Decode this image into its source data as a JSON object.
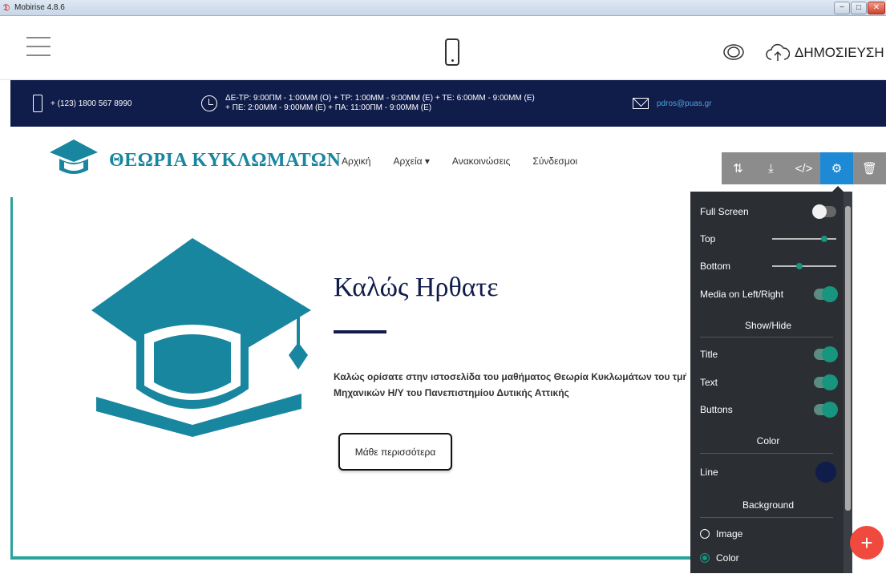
{
  "window": {
    "title": "Mobirise 4.8.6",
    "min": "−",
    "max": "□",
    "close": "✕"
  },
  "toolbar": {
    "publish_label": "ΔΗΜΟΣΙΕΥΣΗ"
  },
  "topbar": {
    "phone": "+ (123) 1800 567 8990",
    "hours_line1": "ΔΕ-ΤΡ: 9:00ΠΜ - 1:00ΜΜ (Ο) + ΤΡ: 1:00ΜΜ - 9:00ΜΜ (Ε) + ΤΕ: 6:00ΜΜ - 9:00ΜΜ (Ε)",
    "hours_line2": "+ ΠΕ: 2:00ΜΜ - 9:00ΜΜ (Ε) + ΠΑ: 11:00ΠΜ - 9:00ΜΜ (Ε)",
    "email": "pdros@puas.gr"
  },
  "navbar": {
    "brand": "ΘΕΩΡΙΑ ΚΥΚΛΩΜΑΤΩΝ",
    "links": [
      "Αρχική",
      "Αρχεία ▾",
      "Ανακοινώσεις",
      "Σύνδεσμοι"
    ]
  },
  "block_tools": [
    "⇅",
    "⤓",
    "</>",
    "⚙",
    "🗑"
  ],
  "hero": {
    "title": "Καλώς Ηρθατε",
    "text_line1": "Καλώς ορίσατε στην ιστοσελίδα του μαθήματος Θεωρία Κυκλωμάτων του τμήματος",
    "text_line2": "Μηχανικών Η/Υ του Πανεπιστημίου Δυτικής Αττικής",
    "button": "Μάθε περισσότερα"
  },
  "panel": {
    "full_screen": "Full Screen",
    "top": "Top",
    "top_value": 0.85,
    "bottom": "Bottom",
    "bottom_value": 0.42,
    "media": "Media on Left/Right",
    "show_hide": "Show/Hide",
    "title": "Title",
    "text": "Text",
    "buttons": "Buttons",
    "color": "Color",
    "line": "Line",
    "background": "Background",
    "image": "Image",
    "color_option": "Color",
    "line_color": "#101c4a"
  },
  "fab": "+",
  "colors": {
    "accent": "#19869f",
    "navy": "#101c4a",
    "teal": "#17957f",
    "fab": "#f0493e"
  }
}
